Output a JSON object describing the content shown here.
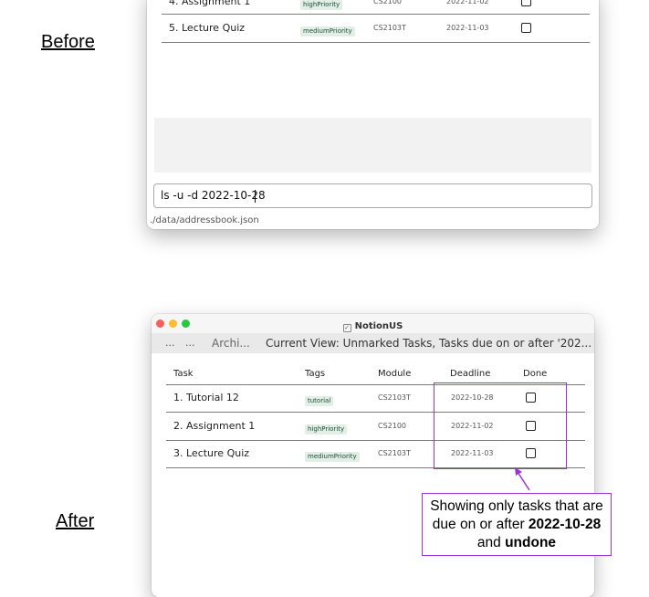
{
  "labels": {
    "before": "Before",
    "after": "After"
  },
  "before_window": {
    "rows": [
      {
        "task": "4. Assignment 1",
        "tag": "highPriority",
        "module": "CS2100",
        "deadline": "2022-11-02"
      },
      {
        "task": "5. Lecture Quiz",
        "tag": "mediumPriority",
        "module": "CS2103T",
        "deadline": "2022-11-03"
      }
    ],
    "command_input": "ls -u -d 2022-10-28",
    "status_path": "./data/addressbook.json"
  },
  "after_window": {
    "title": "NotionUS",
    "menu": {
      "item1": "...",
      "item2": "...",
      "item3": "Archi..."
    },
    "current_view": "Current View: Unmarked Tasks, Tasks due on or after '202...",
    "headers": {
      "task": "Task",
      "tags": "Tags",
      "module": "Module",
      "deadline": "Deadline",
      "done": "Done"
    },
    "rows": [
      {
        "task": "1. Tutorial 12",
        "tag": "tutorial",
        "module": "CS2103T",
        "deadline": "2022-10-28"
      },
      {
        "task": "2. Assignment 1",
        "tag": "highPriority",
        "module": "CS2100",
        "deadline": "2022-11-02"
      },
      {
        "task": "3. Lecture Quiz",
        "tag": "mediumPriority",
        "module": "CS2103T",
        "deadline": "2022-11-03"
      }
    ]
  },
  "annotation": {
    "line1": "Showing only tasks that are",
    "line2_prefix": "due on or after ",
    "line2_bold": "2022-10-28",
    "line3_prefix": "and ",
    "line3_bold": "undone"
  },
  "colors": {
    "highlight": "#9a34d6",
    "tag_bg": "#e1efe6",
    "menu_bg": "#e9e9e9",
    "result_bg": "#f2f2f2"
  }
}
